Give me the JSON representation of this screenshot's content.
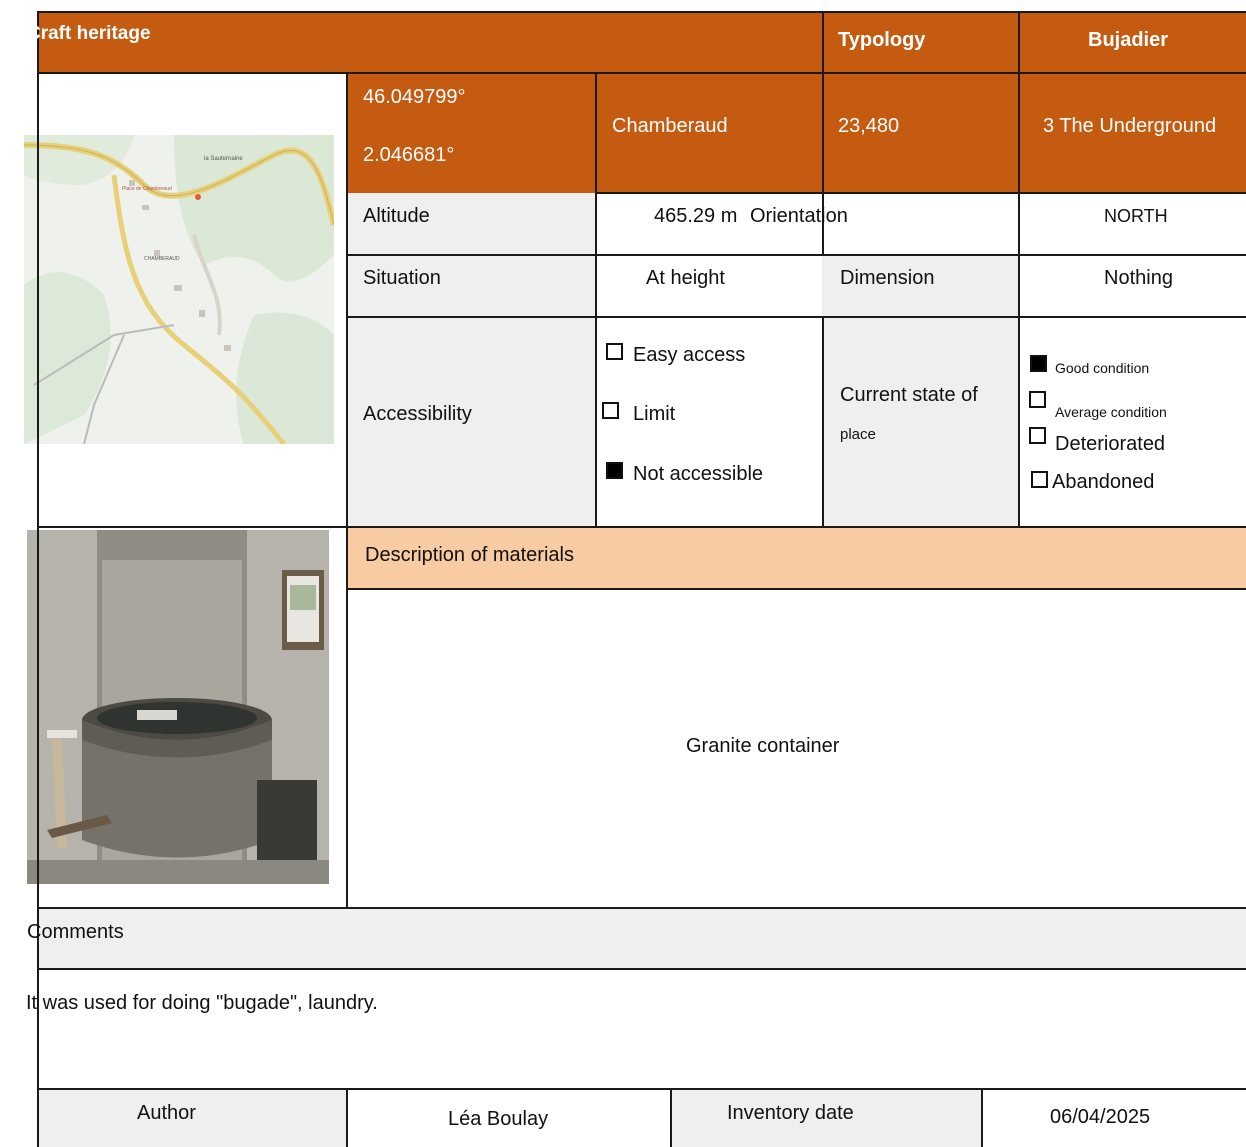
{
  "header": {
    "title": "Craft heritage",
    "typology_label": "Typology",
    "typology_value": "Bujadier"
  },
  "location": {
    "latitude": "46.049799°",
    "longitude": "2.046681°",
    "place": "Chamberaud",
    "code": "23,480",
    "zone": "3 The Underground"
  },
  "map": {
    "labels": [
      "la Sauternaine",
      "Place de Chamberaud",
      "CHAMBERAUD"
    ]
  },
  "details": {
    "altitude_label": "Altitude",
    "altitude_value": "465.29 m",
    "orientation_label": "Orientation",
    "orientation_value": "NORTH",
    "situation_label": "Situation",
    "situation_value": "At height",
    "dimension_label": "Dimension",
    "dimension_value": "Nothing"
  },
  "accessibility": {
    "label": "Accessibility",
    "options": [
      {
        "label": "Easy access",
        "checked": false
      },
      {
        "label": "Limit",
        "checked": false
      },
      {
        "label": "Not accessible",
        "checked": true
      }
    ]
  },
  "state": {
    "label_line1": "Current state of",
    "label_line2": "place",
    "options": [
      {
        "label": "Good condition",
        "checked": true
      },
      {
        "label": "Average condition",
        "checked": false
      },
      {
        "label": "Deteriorated",
        "checked": false
      },
      {
        "label": "Abandoned",
        "checked": false
      }
    ]
  },
  "materials": {
    "label": "Description of materials",
    "value": "Granite container"
  },
  "comments": {
    "label": "Comments",
    "text": "It was used for doing \"bugade\", laundry."
  },
  "footer": {
    "author_label": "Author",
    "author_value": "Léa Boulay",
    "date_label": "Inventory date",
    "date_value": "06/04/2025"
  }
}
